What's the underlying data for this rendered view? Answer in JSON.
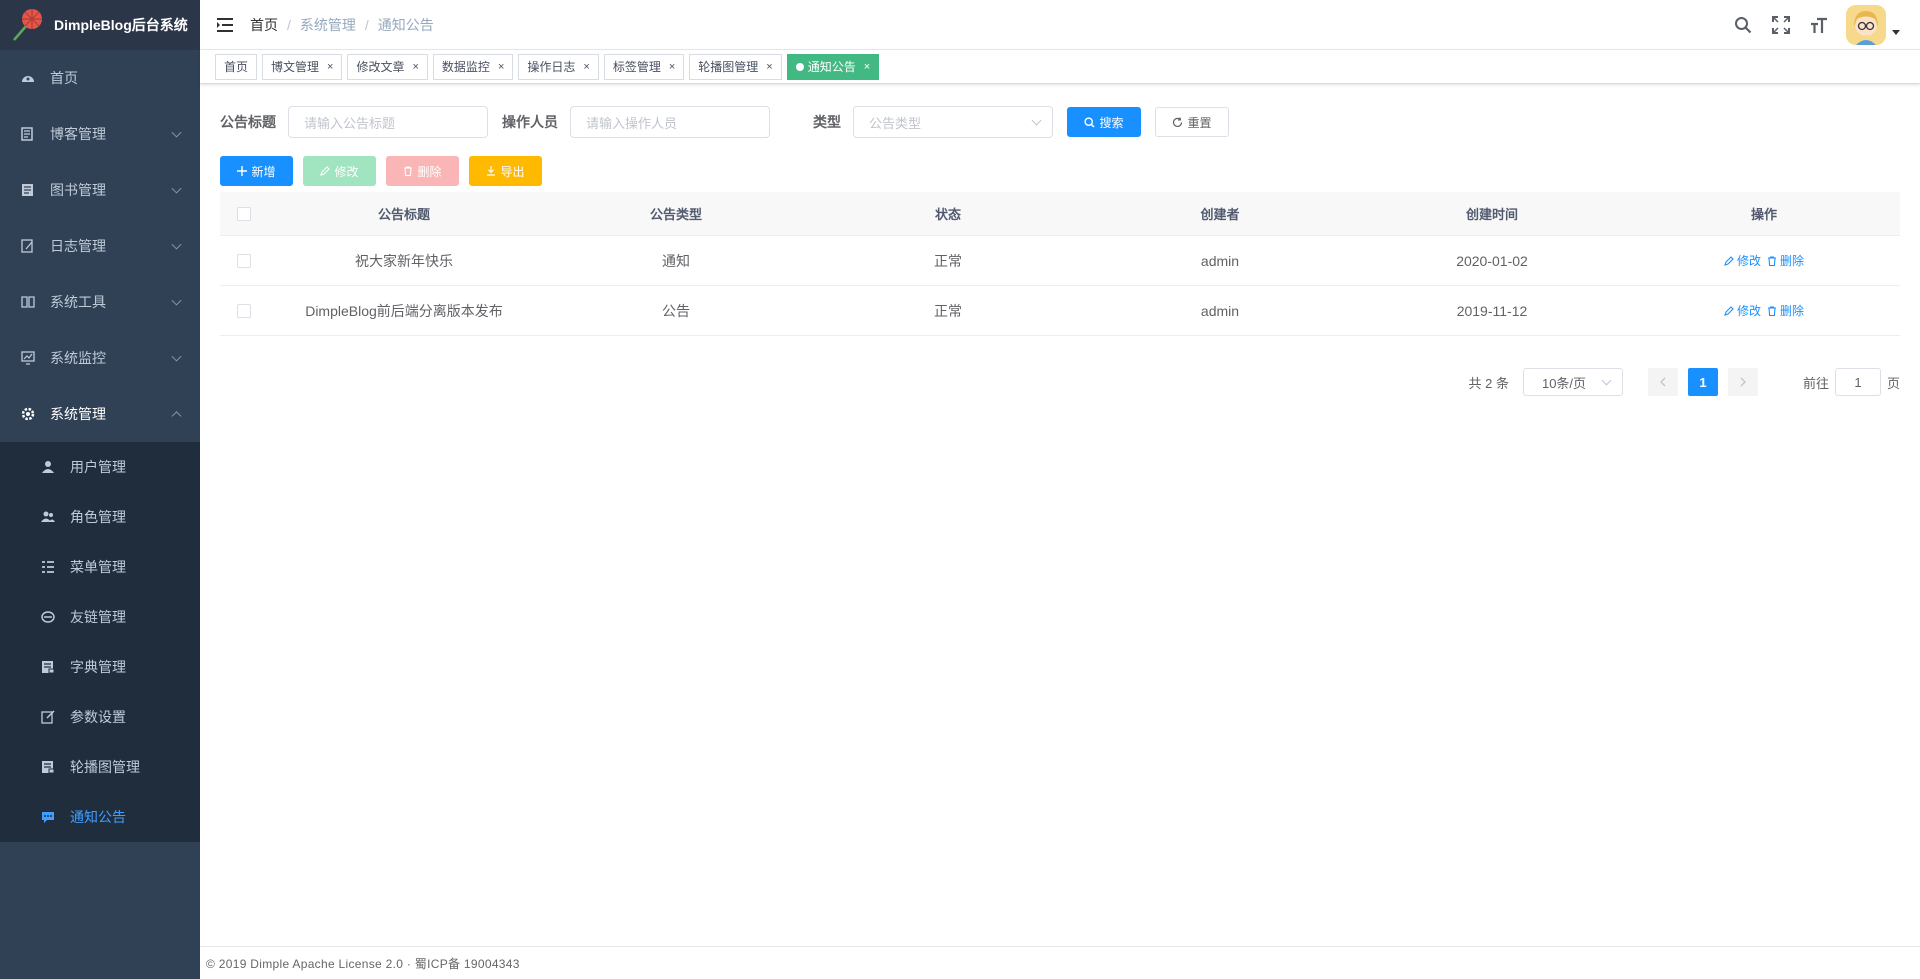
{
  "app": {
    "title": "DimpleBlog后台系统"
  },
  "sidebar": {
    "items": [
      {
        "label": "首页",
        "icon": "dashboard-icon"
      },
      {
        "label": "博客管理",
        "icon": "blog-icon"
      },
      {
        "label": "图书管理",
        "icon": "book-icon"
      },
      {
        "label": "日志管理",
        "icon": "log-icon"
      },
      {
        "label": "系统工具",
        "icon": "tool-icon"
      },
      {
        "label": "系统监控",
        "icon": "monitor-icon"
      },
      {
        "label": "系统管理",
        "icon": "gear-icon"
      }
    ],
    "sub_items": [
      {
        "label": "用户管理",
        "icon": "user-icon"
      },
      {
        "label": "角色管理",
        "icon": "peoples-icon"
      },
      {
        "label": "菜单管理",
        "icon": "tree-table-icon"
      },
      {
        "label": "友链管理",
        "icon": "link-icon"
      },
      {
        "label": "字典管理",
        "icon": "dict-icon"
      },
      {
        "label": "参数设置",
        "icon": "edit-icon"
      },
      {
        "label": "轮播图管理",
        "icon": "carousel-icon"
      },
      {
        "label": "通知公告",
        "icon": "message-icon"
      }
    ]
  },
  "navbar": {
    "breadcrumb": [
      "首页",
      "系统管理",
      "通知公告"
    ]
  },
  "tags": [
    {
      "label": "首页",
      "closable": false
    },
    {
      "label": "博文管理",
      "closable": true
    },
    {
      "label": "修改文章",
      "closable": true
    },
    {
      "label": "数据监控",
      "closable": true
    },
    {
      "label": "操作日志",
      "closable": true
    },
    {
      "label": "标签管理",
      "closable": true
    },
    {
      "label": "轮播图管理",
      "closable": true
    },
    {
      "label": "通知公告",
      "closable": true,
      "active": true
    }
  ],
  "search": {
    "title_label": "公告标题",
    "title_placeholder": "请输入公告标题",
    "operator_label": "操作人员",
    "operator_placeholder": "请输入操作人员",
    "type_label": "类型",
    "type_placeholder": "公告类型",
    "search_button": "搜索",
    "reset_button": "重置"
  },
  "toolbar": {
    "add": "新增",
    "edit": "修改",
    "delete": "删除",
    "export": "导出"
  },
  "table": {
    "headers": [
      "公告标题",
      "公告类型",
      "状态",
      "创建者",
      "创建时间",
      "操作"
    ],
    "rows": [
      {
        "title": "祝大家新年快乐",
        "type": "通知",
        "status": "正常",
        "creator": "admin",
        "created": "2020-01-02"
      },
      {
        "title": "DimpleBlog前后端分离版本发布",
        "type": "公告",
        "status": "正常",
        "creator": "admin",
        "created": "2019-11-12"
      }
    ],
    "op_edit": "修改",
    "op_delete": "删除"
  },
  "pagination": {
    "total": "共 2 条",
    "page_size": "10条/页",
    "current_page": "1",
    "goto_label": "前往",
    "goto_value": "1",
    "page_unit": "页"
  },
  "footer": {
    "text": "© 2019 Dimple Apache License 2.0 · 蜀ICP备 19004343"
  },
  "colors": {
    "sidebar_bg": "#304156",
    "primary": "#1890ff",
    "active_tag": "#42b983"
  }
}
